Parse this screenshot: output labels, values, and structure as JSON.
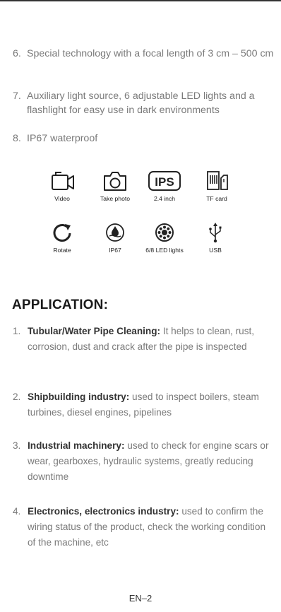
{
  "features": [
    {
      "num": "6.",
      "text": "Special technology with a focal length of 3 cm – 500 cm"
    },
    {
      "num": "7.",
      "text": "Auxiliary light source, 6 adjustable LED lights and a flashlight for easy use in dark environments"
    },
    {
      "num": "8.",
      "text": "IP67 waterproof"
    }
  ],
  "icons": {
    "video": "Video",
    "photo": "Take photo",
    "ips_badge": "IPS",
    "screen": "2.4 inch",
    "tf": "TF card",
    "rotate": "Rotate",
    "ip67": "IP67",
    "led": "6/8 LED lights",
    "usb": "USB"
  },
  "application": {
    "title": "APPLICATION:",
    "items": [
      {
        "num": "1.",
        "bold": "Tubular/Water Pipe Cleaning:",
        "text": " It helps to clean, rust, corrosion, dust and crack after the pipe is inspected"
      },
      {
        "num": "2.",
        "bold": "Shipbuilding industry:",
        "text": " used to inspect boilers, steam turbines, diesel engines, pipelines"
      },
      {
        "num": "3.",
        "bold": "Industrial machinery:",
        "text": " used to check for engine scars or wear, gearboxes, hydraulic systems, greatly reducing downtime"
      },
      {
        "num": "4.",
        "bold": "Electronics, electronics industry:",
        "text": " used to confirm the wiring status of the product, check the working condition of the machine, etc"
      }
    ]
  },
  "footer": "EN–2"
}
